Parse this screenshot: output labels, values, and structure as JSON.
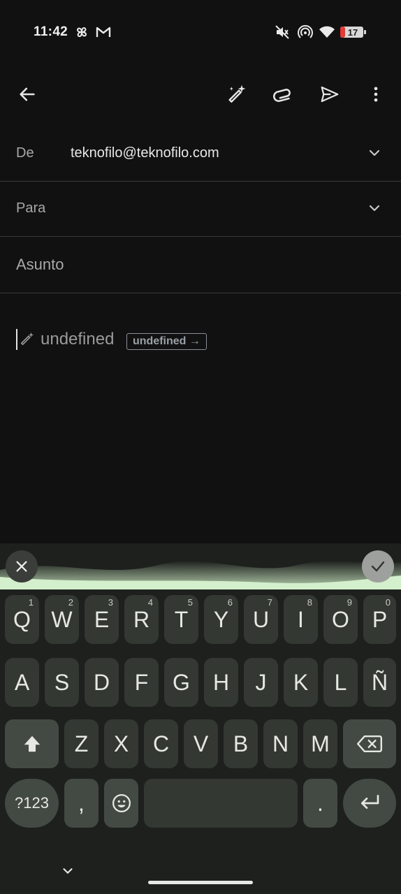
{
  "status_bar": {
    "time": "11:42",
    "battery_level": "17",
    "icons": [
      "pinwheel-icon",
      "gmail-icon",
      "mute-icon",
      "hotspot-icon",
      "wifi-icon",
      "battery-icon"
    ]
  },
  "toolbar": {
    "icons": [
      "back-arrow-icon",
      "help-me-write-icon",
      "attach-icon",
      "send-icon",
      "more-vert-icon"
    ]
  },
  "compose": {
    "from_label": "De",
    "from_value": "teknofilo@teknofilo.com",
    "to_label": "Para",
    "subject_placeholder": "Asunto",
    "help_me_write_text": "undefined",
    "help_me_write_chip": "undefined →"
  },
  "keyboard": {
    "row1": [
      {
        "label": "Q",
        "hint": "1"
      },
      {
        "label": "W",
        "hint": "2"
      },
      {
        "label": "E",
        "hint": "3"
      },
      {
        "label": "R",
        "hint": "4"
      },
      {
        "label": "T",
        "hint": "5"
      },
      {
        "label": "Y",
        "hint": "6"
      },
      {
        "label": "U",
        "hint": "7"
      },
      {
        "label": "I",
        "hint": "8"
      },
      {
        "label": "O",
        "hint": "9"
      },
      {
        "label": "P",
        "hint": "0"
      }
    ],
    "row2": [
      "A",
      "S",
      "D",
      "F",
      "G",
      "H",
      "J",
      "K",
      "L",
      "Ñ"
    ],
    "row3": [
      "Z",
      "X",
      "C",
      "V",
      "B",
      "N",
      "M"
    ],
    "symbols_label": "?123",
    "comma_label": ",",
    "period_label": ".",
    "colors": {
      "accent": "#c9ecc0",
      "key": "#333833",
      "func_key": "#434943",
      "background": "#1d201d"
    }
  }
}
